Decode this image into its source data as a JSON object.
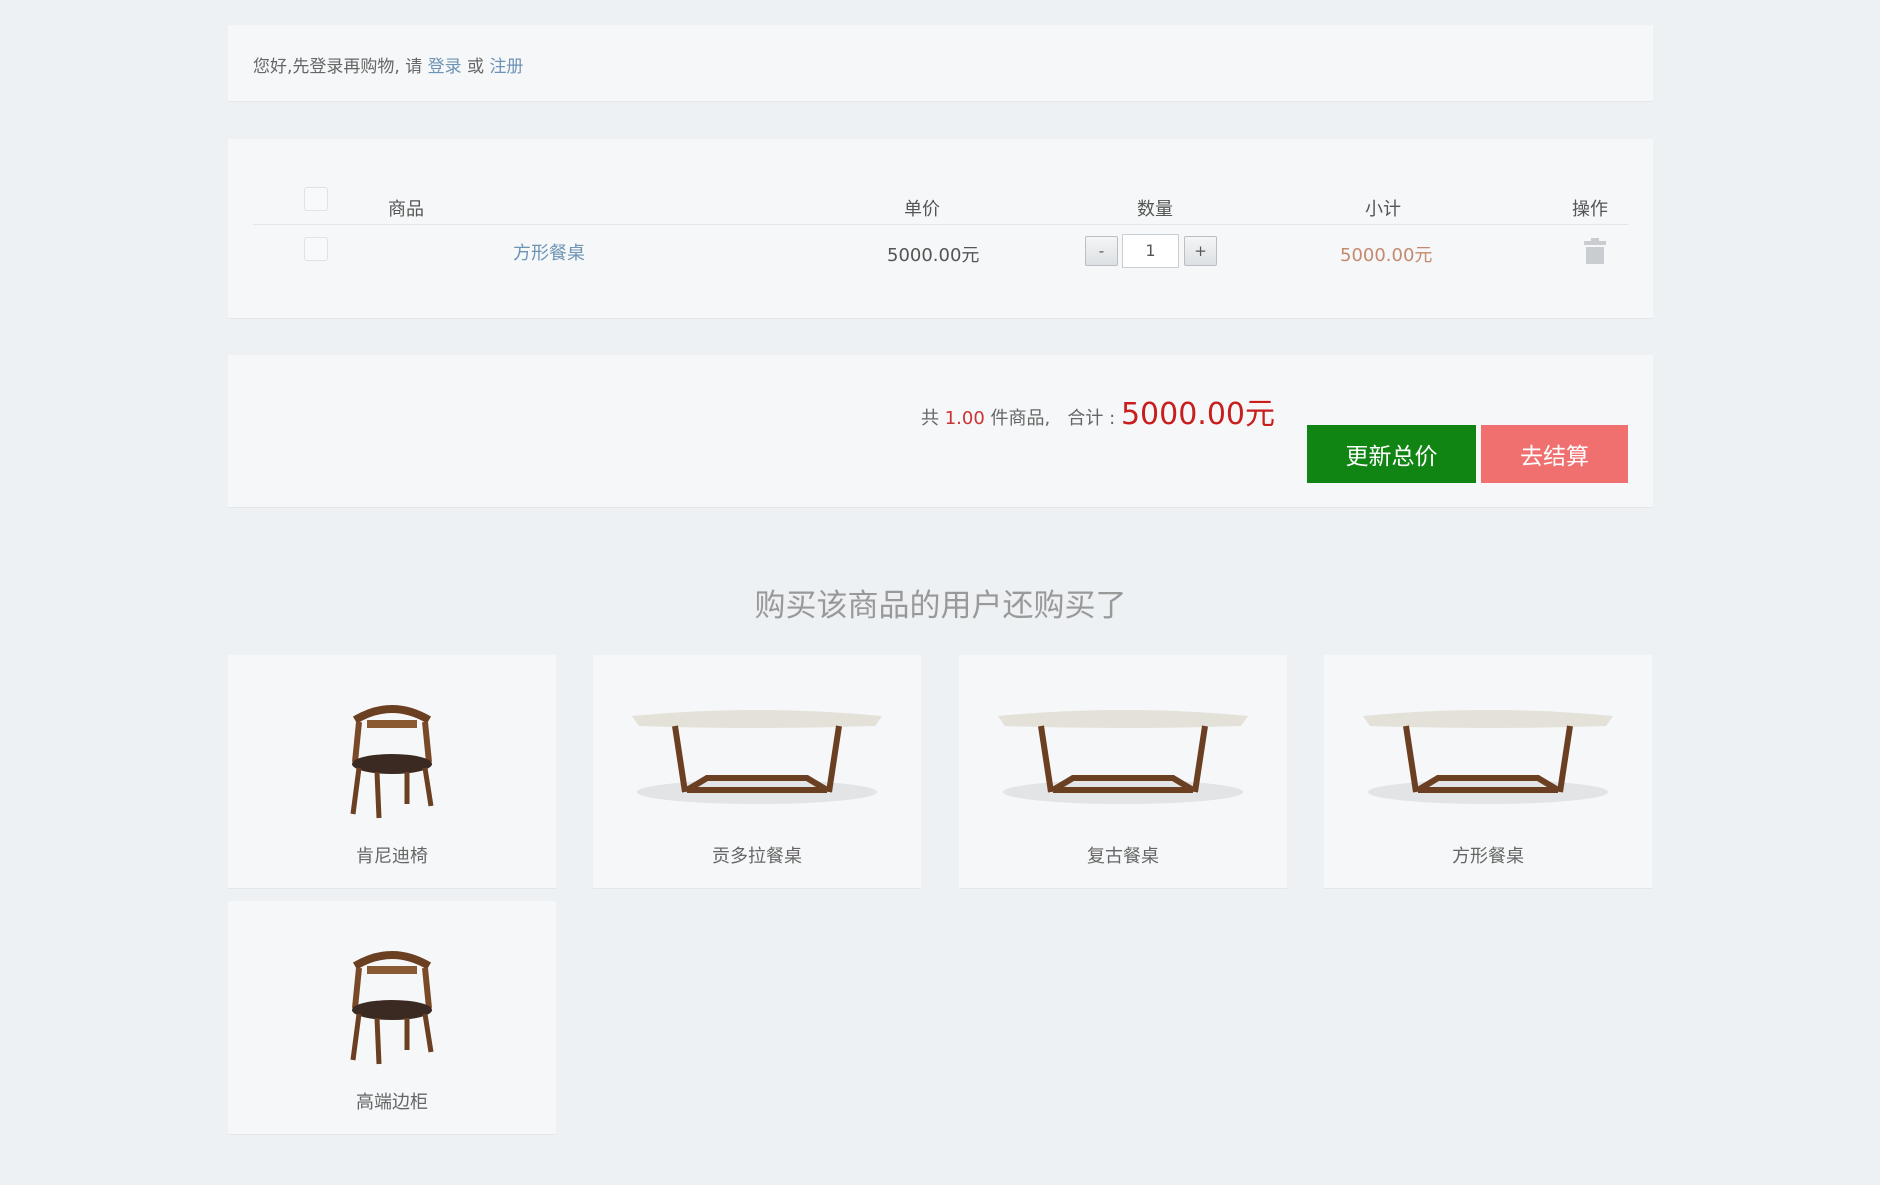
{
  "notice": {
    "text": "您好,先登录再购物, 请 ",
    "login": "登录",
    "or": " 或 ",
    "register": "注册"
  },
  "cart": {
    "headers": {
      "product": "商品",
      "price": "单价",
      "qty": "数量",
      "subtotal": "小计",
      "action": "操作"
    },
    "items": [
      {
        "name": "方形餐桌",
        "price": "5000.00元",
        "qty": "1",
        "subtotal": "5000.00元"
      }
    ],
    "minus": "-",
    "plus": "+"
  },
  "summary": {
    "prefix": "共 ",
    "count": "1.00",
    "mid": " 件商品,   合计 : ",
    "total": "5000.00元",
    "update_label": "更新总价",
    "checkout_label": "去结算"
  },
  "recommend": {
    "title": "购买该商品的用户还购买了",
    "items": [
      {
        "name": "肯尼迪椅",
        "image": "chair"
      },
      {
        "name": "贡多拉餐桌",
        "image": "table"
      },
      {
        "name": "复古餐桌",
        "image": "table"
      },
      {
        "name": "方形餐桌",
        "image": "table"
      },
      {
        "name": "高端边柜",
        "image": "chair"
      }
    ]
  },
  "colors": {
    "update_button": "#118514",
    "checkout_button": "#f07070",
    "link": "#6e93b5",
    "price_red": "#c81e1e"
  }
}
